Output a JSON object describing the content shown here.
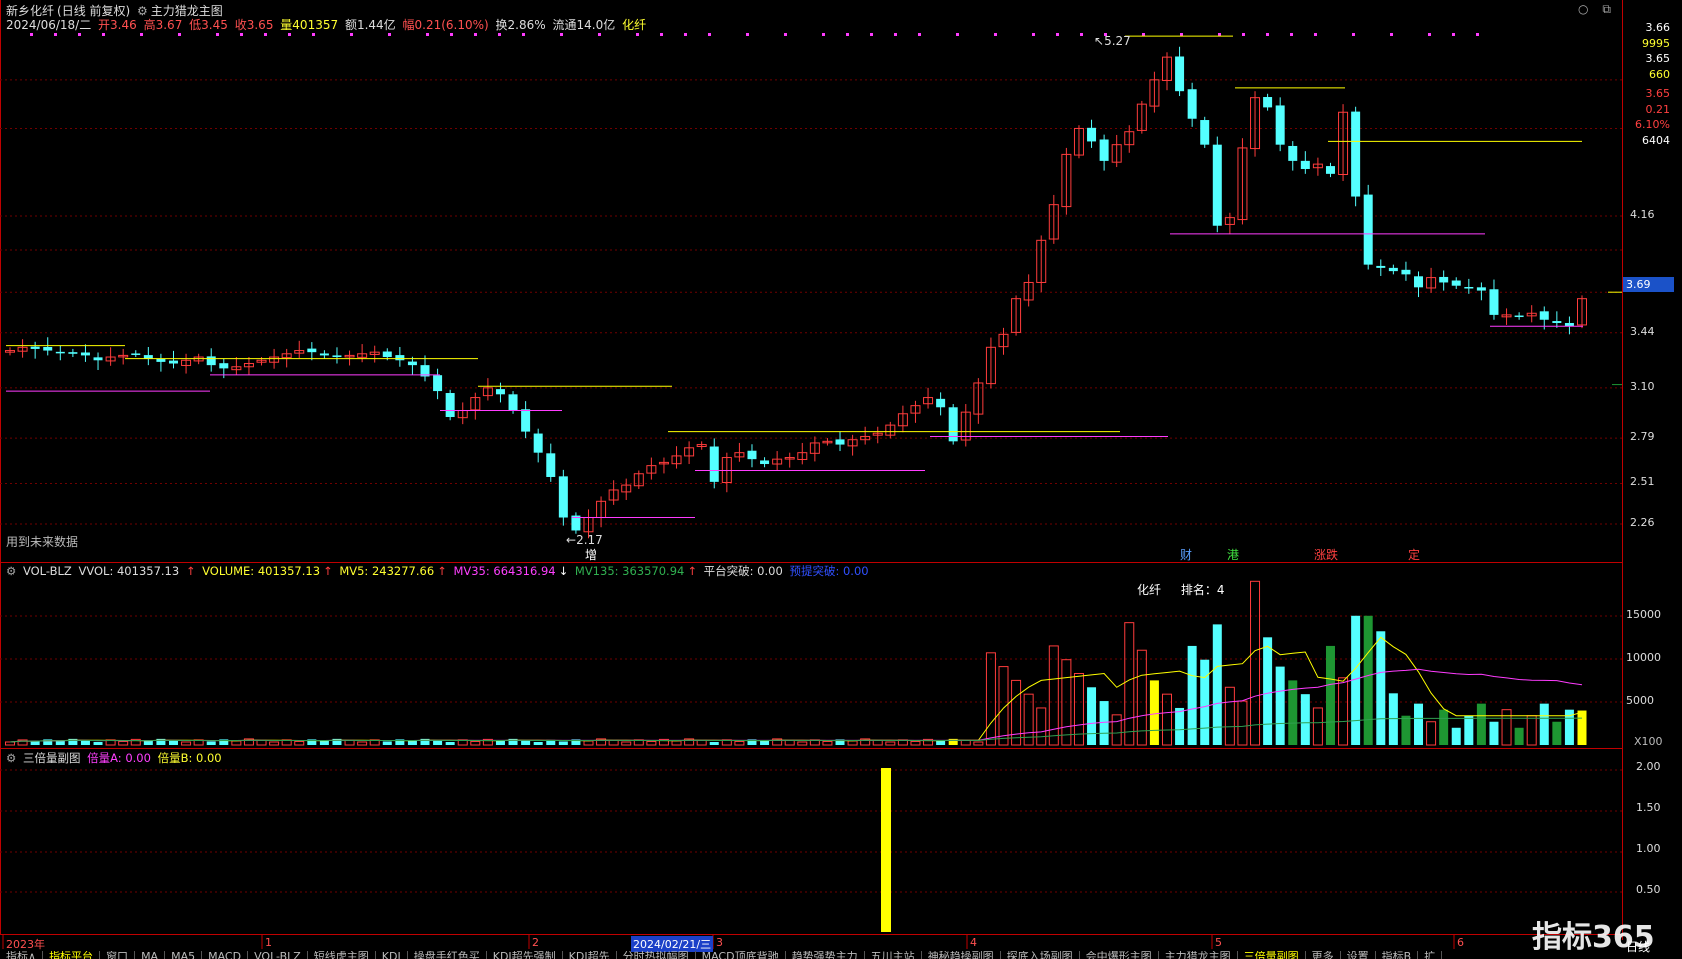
{
  "header": {
    "stock_name": "新乡化纤",
    "mode": "(日线 前复权)",
    "indicator": "主力猎龙主图",
    "date": "2024/06/18/二",
    "open": "开3.46",
    "high": "高3.67",
    "low": "低3.45",
    "close": "收3.65",
    "volume": "量401357",
    "amount": "额1.44亿",
    "change": "幅0.21(6.10%)",
    "turnover": "换2.86%",
    "float_cap": "流通14.0亿",
    "sector": "化纤"
  },
  "main_chart": {
    "future_note": "用到未来数据",
    "high_label": "5.27",
    "low_label": "2.17",
    "price_ticks": [
      "4.16",
      "3.44",
      "3.10",
      "2.79",
      "2.51",
      "2.26"
    ],
    "current_price": "3.69",
    "right_info": [
      "3.66",
      "9995",
      "3.65",
      "660",
      "3.65",
      "0.21",
      "6.10%",
      "6404"
    ],
    "markers": [
      {
        "text": "增",
        "color": "#ffffff"
      },
      {
        "text": "财",
        "color": "#5aa0ff"
      },
      {
        "text": "港",
        "color": "#40e040"
      },
      {
        "text": "涨跌",
        "color": "#ff4040"
      },
      {
        "text": "定",
        "color": "#ff4040"
      }
    ]
  },
  "volume_panel": {
    "name": "VOL-BLZ",
    "vol": "VVOL: 401357.13",
    "volume": "VOLUME: 401357.13",
    "mv5": "MV5: 243277.66",
    "mv35": "MV35: 664316.94",
    "mv135": "MV135: 363570.94",
    "platform": "平台突破: 0.00",
    "breakout": "预提突破: 0.00",
    "rank_sector": "化纤",
    "rank": "排名：4",
    "ticks": [
      "15000",
      "10000",
      "5000"
    ],
    "scale": "X100"
  },
  "sub_panel": {
    "name": "三倍量副图",
    "a_label": "倍量A: 0.00",
    "b_label": "倍量B: 0.00",
    "ticks": [
      "2.00",
      "1.50",
      "1.00",
      "0.50"
    ]
  },
  "time_axis": {
    "labels": [
      "2023年",
      "1",
      "2",
      "3",
      "4",
      "5",
      "6"
    ],
    "cursor_date": "2024/02/21/三"
  },
  "tabs": [
    "指标∧",
    "指标平台",
    "窗口",
    "MA",
    "MA5",
    "MACD",
    "VOL-BLZ",
    "短线虎主图",
    "KDJ",
    "操盘手红色买",
    "KDJ超先强制",
    "KDJ超先",
    "分时热拟幅图",
    "MACD顶底背驰",
    "趋势强势主力",
    "五川主站",
    "神秘趋操副图",
    "探底入场副图",
    "会中爆形主图",
    "主力猎龙主图",
    "三倍量副图",
    "更多",
    "设置"
  ],
  "tabs_right": [
    "指标B",
    "扩"
  ],
  "period": "日线",
  "brand": "指标365",
  "colors": {
    "up": "#ff3c3c",
    "down": "#54ffff",
    "yellow": "#ffff00",
    "magenta": "#ff3cff",
    "green": "#1e9632"
  }
}
